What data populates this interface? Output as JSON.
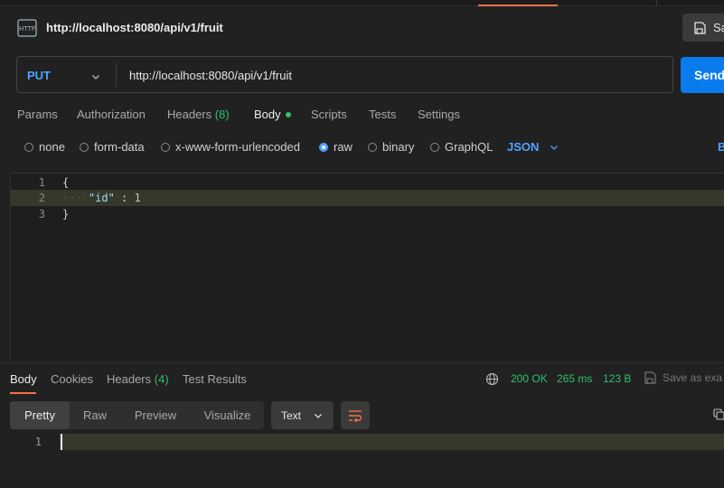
{
  "request": {
    "title": "http://localhost:8080/api/v1/fruit",
    "save_label": "Sa",
    "method": "PUT",
    "url": "http://localhost:8080/api/v1/fruit",
    "send_label": "Send"
  },
  "tabs": [
    {
      "label": "Params"
    },
    {
      "label": "Authorization"
    },
    {
      "label": "Headers",
      "count": "(8)"
    },
    {
      "label": "Body"
    },
    {
      "label": "Scripts"
    },
    {
      "label": "Tests"
    },
    {
      "label": "Settings"
    }
  ],
  "body_types": [
    "none",
    "form-data",
    "x-www-form-urlencoded",
    "raw",
    "binary",
    "GraphQL"
  ],
  "body_format": "JSON",
  "beautify_label": "B",
  "editor": {
    "line_numbers": [
      "1",
      "2",
      "3"
    ],
    "line1": "{",
    "key": "\"id\"",
    "colon": " : ",
    "value": "1",
    "line3": "}"
  },
  "response": {
    "tabs": [
      {
        "label": "Body"
      },
      {
        "label": "Cookies"
      },
      {
        "label": "Headers",
        "count": "(4)"
      },
      {
        "label": "Test Results"
      }
    ],
    "status": "200 OK",
    "time": "265 ms",
    "size": "123 B",
    "save_example": "Save as exa",
    "views": [
      "Pretty",
      "Raw",
      "Preview",
      "Visualize"
    ],
    "text_format": "Text",
    "line_number": "1"
  },
  "colors": {
    "accent": "#f2734a",
    "send": "#097bed",
    "success": "#2fbf71",
    "link": "#4fa3ff"
  }
}
